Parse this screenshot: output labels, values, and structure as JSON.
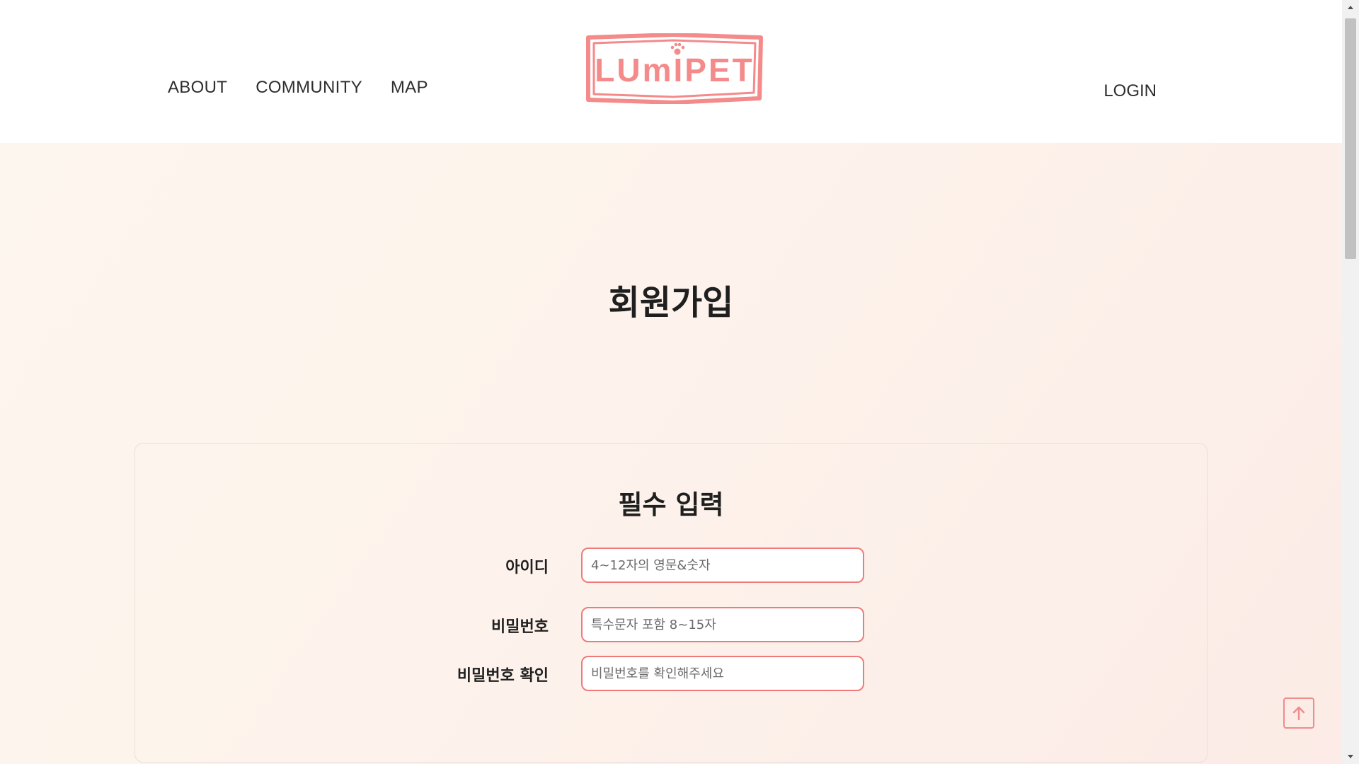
{
  "header": {
    "nav": [
      {
        "label": "ABOUT"
      },
      {
        "label": "COMMUNITY"
      },
      {
        "label": "MAP"
      }
    ],
    "logo_text": "LUmIPET",
    "login_label": "LOGIN"
  },
  "main": {
    "title": "회원가입",
    "section_title": "필수 입력",
    "fields": [
      {
        "label": "아이디",
        "placeholder": "4~12자의 영문&숫자"
      },
      {
        "label": "비밀번호",
        "placeholder": "특수문자 포함 8~15자"
      },
      {
        "label": "비밀번호 확인",
        "placeholder": "비밀번호를 확인해주세요"
      }
    ]
  },
  "colors": {
    "accent": "#f07a7a",
    "logo": "#f48a8a",
    "background": "#fdf5ee"
  },
  "icons": {
    "scroll_top": "arrow-up-icon",
    "logo_paw": "paw-icon"
  }
}
